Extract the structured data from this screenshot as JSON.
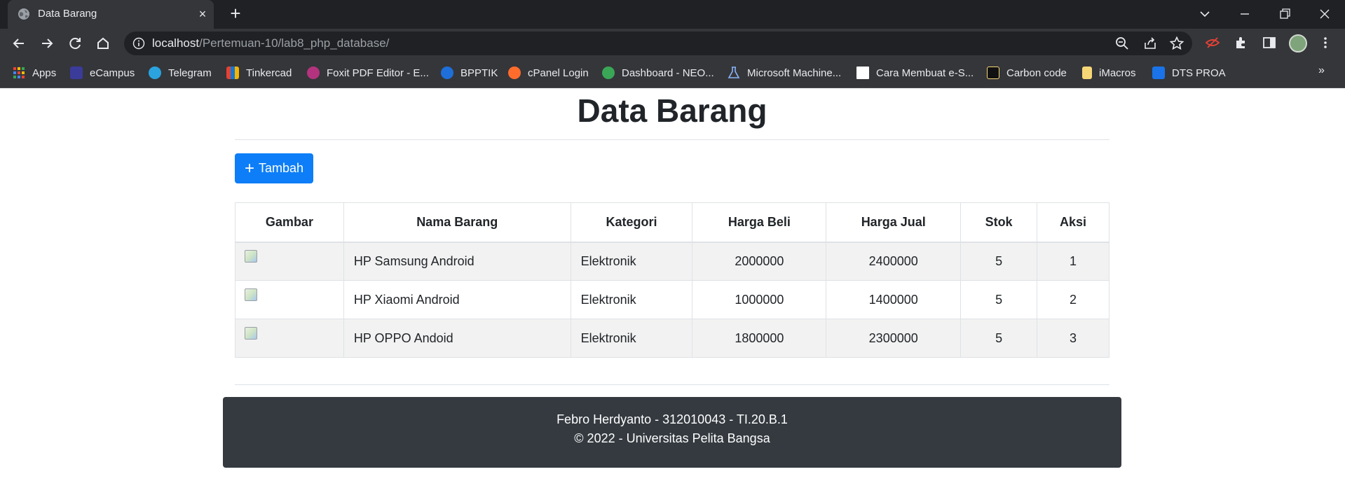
{
  "browser": {
    "tab": {
      "title": "Data Barang",
      "close_icon": "×",
      "new_tab_icon": "+"
    },
    "address": {
      "host": "localhost",
      "path": "/Pertemuan-10/lab8_php_database/"
    },
    "bookmarks": [
      {
        "label": "Apps",
        "color": "#e94235"
      },
      {
        "label": "eCampus",
        "color": "#3b3b9a"
      },
      {
        "label": "Telegram",
        "color": "#2aa3df"
      },
      {
        "label": "Tinkercad",
        "color": "#e34234"
      },
      {
        "label": "Foxit PDF Editor - E...",
        "color": "#b3337e"
      },
      {
        "label": "BPPTIK",
        "color": "#1e6fd9"
      },
      {
        "label": "cPanel Login",
        "color": "#ff6c2c"
      },
      {
        "label": "Dashboard - NEO...",
        "color": "#3aa757"
      },
      {
        "label": "Microsoft Machine...",
        "color": "#8ab4f8"
      },
      {
        "label": "Cara Membuat e-S...",
        "color": "#ffffff"
      },
      {
        "label": "Carbon code",
        "color": "#111111"
      },
      {
        "label": "iMacros",
        "color": "#f6d776"
      },
      {
        "label": "DTS PROA",
        "color": "#1a73e8"
      }
    ],
    "bookmarks_more": "»"
  },
  "page": {
    "title": "Data Barang",
    "add_button": {
      "icon": "+",
      "label": "Tambah"
    },
    "table": {
      "headers": [
        "Gambar",
        "Nama Barang",
        "Kategori",
        "Harga Beli",
        "Harga Jual",
        "Stok",
        "Aksi"
      ],
      "rows": [
        {
          "nama": "HP Samsung Android",
          "kategori": "Elektronik",
          "harga_beli": "2000000",
          "harga_jual": "2400000",
          "stok": "5",
          "aksi": "1"
        },
        {
          "nama": "HP Xiaomi Android",
          "kategori": "Elektronik",
          "harga_beli": "1000000",
          "harga_jual": "1400000",
          "stok": "5",
          "aksi": "2"
        },
        {
          "nama": "HP OPPO Andoid",
          "kategori": "Elektronik",
          "harga_beli": "1800000",
          "harga_jual": "2300000",
          "stok": "5",
          "aksi": "3"
        }
      ]
    },
    "footer": {
      "line1": "Febro Herdyanto - 312010043 - TI.20.B.1",
      "line2": "© 2022 - Universitas Pelita Bangsa"
    }
  },
  "colors": {
    "primary_button": "#0d7ef7",
    "footer_bg": "#343a40",
    "stripe": "#f2f2f2"
  }
}
